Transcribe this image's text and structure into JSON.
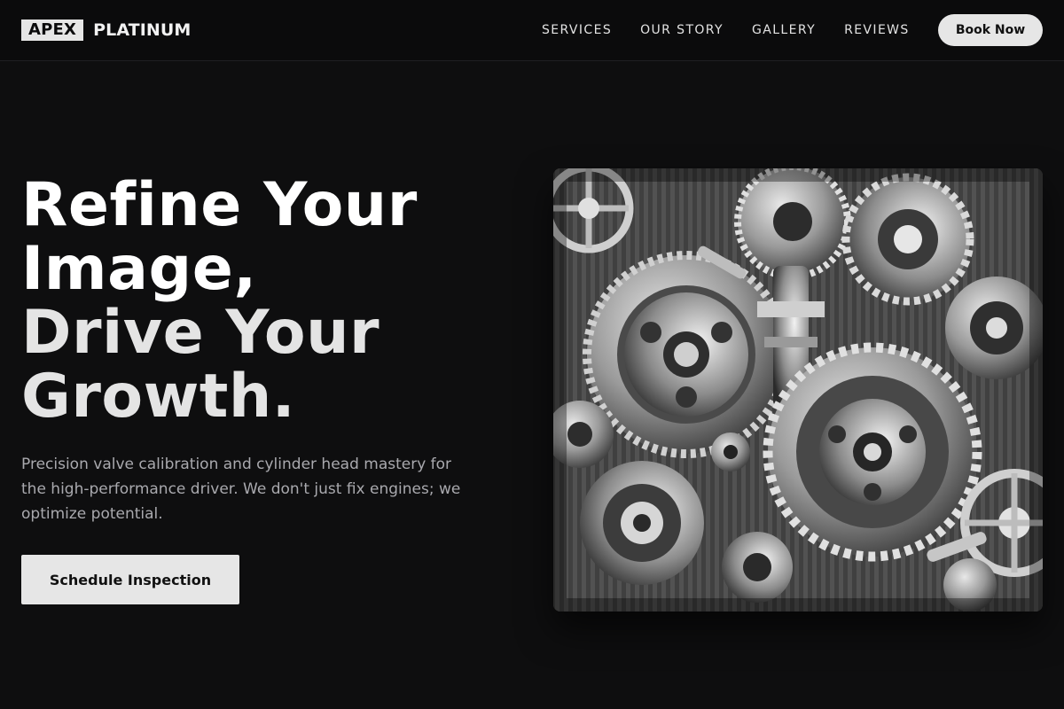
{
  "brand": {
    "logo_box": "APEX",
    "logo_rest": "PLATINUM"
  },
  "nav": {
    "items": [
      {
        "label": "SERVICES"
      },
      {
        "label": "OUR STORY"
      },
      {
        "label": "GALLERY"
      },
      {
        "label": "REVIEWS"
      }
    ],
    "cta_label": "Book Now"
  },
  "hero": {
    "title_lines": [
      "Refine Your",
      "Image,",
      "Drive Your",
      "Growth."
    ],
    "subtitle": "Precision valve calibration and cylinder head mastery for the high-performance driver. We don't just fix engines; we optimize potential.",
    "cta_label": "Schedule Inspection",
    "image_icon": "engine-gears-image"
  },
  "colors": {
    "background": "#0e0e0f",
    "accent": "#e6e6e6",
    "subtitle": "#a9a9ae"
  }
}
